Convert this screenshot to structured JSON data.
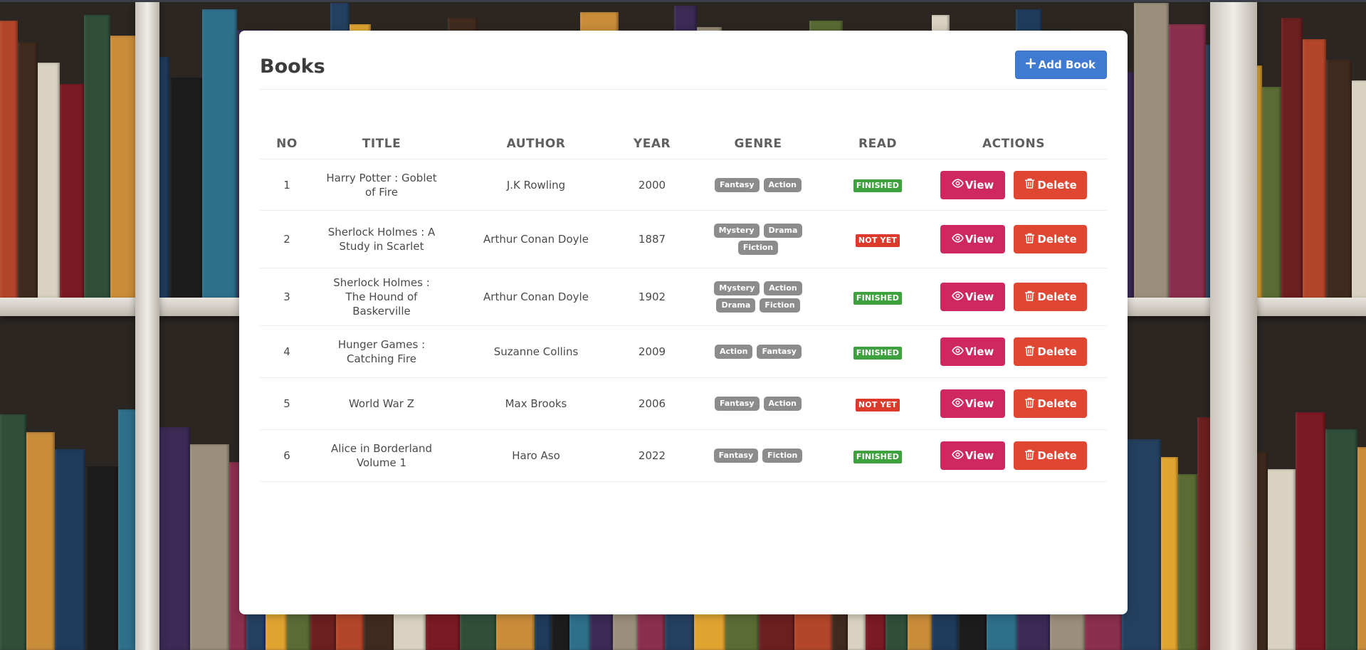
{
  "page": {
    "title": "Books",
    "add_button_label": "Add Book"
  },
  "table": {
    "headers": [
      "NO",
      "TITLE",
      "AUTHOR",
      "YEAR",
      "GENRE",
      "READ",
      "ACTIONS"
    ],
    "view_label": "View",
    "delete_label": "Delete",
    "rows": [
      {
        "no": "1",
        "title": "Harry Potter : Goblet of Fire",
        "author": "J.K Rowling",
        "year": "2000",
        "genres": [
          "Fantasy",
          "Action"
        ],
        "read": "FINISHED"
      },
      {
        "no": "2",
        "title": "Sherlock Holmes : A Study in Scarlet",
        "author": "Arthur Conan Doyle",
        "year": "1887",
        "genres": [
          "Mystery",
          "Drama",
          "Fiction"
        ],
        "read": "NOT YET"
      },
      {
        "no": "3",
        "title": "Sherlock Holmes : The Hound of Baskerville",
        "author": "Arthur Conan Doyle",
        "year": "1902",
        "genres": [
          "Mystery",
          "Action",
          "Drama",
          "Fiction"
        ],
        "read": "FINISHED"
      },
      {
        "no": "4",
        "title": "Hunger Games : Catching Fire",
        "author": "Suzanne Collins",
        "year": "2009",
        "genres": [
          "Action",
          "Fantasy"
        ],
        "read": "FINISHED"
      },
      {
        "no": "5",
        "title": "World War Z",
        "author": "Max Brooks",
        "year": "2006",
        "genres": [
          "Fantasy",
          "Action"
        ],
        "read": "NOT YET"
      },
      {
        "no": "6",
        "title": "Alice in Borderland Volume 1",
        "author": "Haro Aso",
        "year": "2022",
        "genres": [
          "Fantasy",
          "Fiction"
        ],
        "read": "FINISHED"
      }
    ]
  },
  "colors": {
    "add_button": "#3e7bd1",
    "view_button": "#cf2760",
    "delete_button": "#df4733",
    "finished_badge": "#3da23d",
    "not_yet_badge": "#dc3b2c",
    "genre_tag": "#8c8c8c"
  },
  "icons": {
    "add": "plus-icon",
    "view": "eye-icon",
    "delete": "trash-icon"
  }
}
